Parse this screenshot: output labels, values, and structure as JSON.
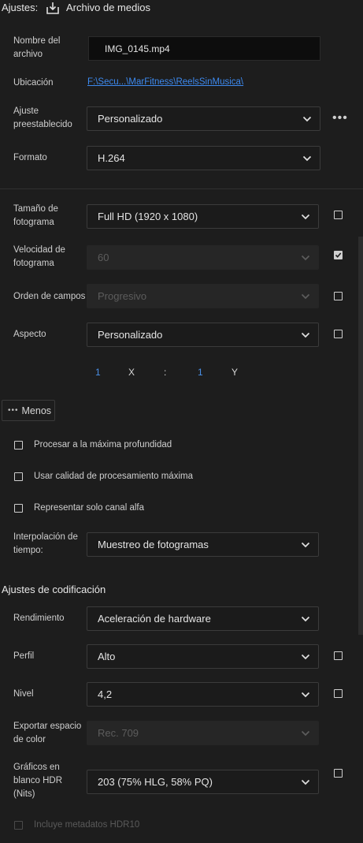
{
  "header": {
    "label": "Ajustes:",
    "title": "Archivo de medios",
    "icon": "export-icon"
  },
  "fields": {
    "filename": {
      "label1": "Nombre del",
      "label2": "archivo",
      "value": "IMG_0145.mp4"
    },
    "location": {
      "label": "Ubicación",
      "value": "F:\\Secu...\\MarFitness\\ReelsSinMusica\\"
    },
    "preset": {
      "label1": "Ajuste",
      "label2": "preestablecido",
      "value": "Personalizado",
      "more": "•••"
    },
    "format": {
      "label": "Formato",
      "value": "H.264"
    },
    "frame_size": {
      "label1": "Tamaño de",
      "label2": "fotograma",
      "value": "Full HD (1920 x 1080)",
      "checked": false
    },
    "frame_rate": {
      "label1": "Velocidad de",
      "label2": "fotograma",
      "value": "60",
      "checked": true,
      "disabled": true
    },
    "field_order": {
      "label": "Orden de campos",
      "value": "Progresivo",
      "checked": false,
      "disabled": true
    },
    "aspect": {
      "label": "Aspecto",
      "value": "Personalizado",
      "checked": false
    },
    "aspect_ratio": {
      "x_value": "1",
      "x_label": "X",
      "sep": ":",
      "y_value": "1",
      "y_label": "Y"
    },
    "less_button": {
      "dots": "•••",
      "label": "Menos"
    },
    "max_depth": {
      "label": "Procesar a la máxima profundidad",
      "checked": false
    },
    "max_quality": {
      "label": "Usar calidad de procesamiento máxima",
      "checked": false
    },
    "alpha_only": {
      "label": "Representar solo canal alfa",
      "checked": false
    },
    "interpolation": {
      "label1": "Interpolación de",
      "label2": "tiempo:",
      "value": "Muestreo de fotogramas"
    }
  },
  "encoding": {
    "title": "Ajustes de codificación",
    "performance": {
      "label": "Rendimiento",
      "value": "Aceleración de hardware"
    },
    "profile": {
      "label": "Perfil",
      "value": "Alto",
      "checked": false
    },
    "level": {
      "label": "Nivel",
      "value": "4,2",
      "checked": false
    },
    "color_space": {
      "label1": "Exportar espacio",
      "label2": "de color",
      "value": "Rec. 709",
      "disabled": true
    },
    "hdr_white": {
      "label1": "Gráficos en",
      "label2": "blanco HDR",
      "label3": "(Nits)",
      "value": "203 (75% HLG, 58% PQ)",
      "checked": false
    },
    "hdr_metadata": {
      "label": "Incluye metadatos HDR10",
      "checked": false,
      "disabled": true
    }
  }
}
